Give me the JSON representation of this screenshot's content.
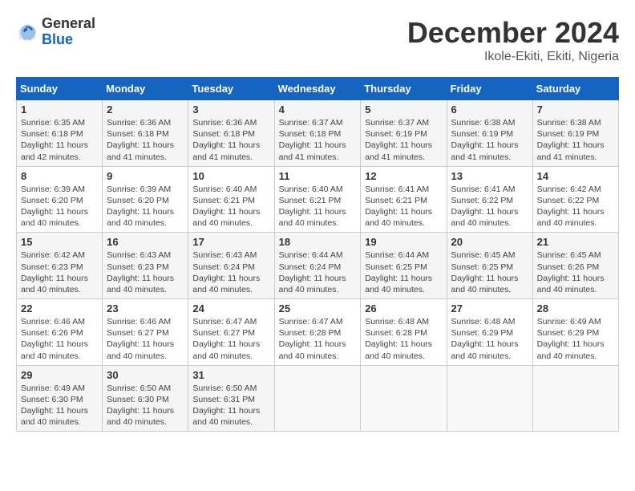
{
  "header": {
    "logo_general": "General",
    "logo_blue": "Blue",
    "month_title": "December 2024",
    "location": "Ikole-Ekiti, Ekiti, Nigeria"
  },
  "days_of_week": [
    "Sunday",
    "Monday",
    "Tuesday",
    "Wednesday",
    "Thursday",
    "Friday",
    "Saturday"
  ],
  "weeks": [
    [
      {
        "day": "1",
        "sunrise": "6:35 AM",
        "sunset": "6:18 PM",
        "daylight": "11 hours and 42 minutes."
      },
      {
        "day": "2",
        "sunrise": "6:36 AM",
        "sunset": "6:18 PM",
        "daylight": "11 hours and 41 minutes."
      },
      {
        "day": "3",
        "sunrise": "6:36 AM",
        "sunset": "6:18 PM",
        "daylight": "11 hours and 41 minutes."
      },
      {
        "day": "4",
        "sunrise": "6:37 AM",
        "sunset": "6:18 PM",
        "daylight": "11 hours and 41 minutes."
      },
      {
        "day": "5",
        "sunrise": "6:37 AM",
        "sunset": "6:19 PM",
        "daylight": "11 hours and 41 minutes."
      },
      {
        "day": "6",
        "sunrise": "6:38 AM",
        "sunset": "6:19 PM",
        "daylight": "11 hours and 41 minutes."
      },
      {
        "day": "7",
        "sunrise": "6:38 AM",
        "sunset": "6:19 PM",
        "daylight": "11 hours and 41 minutes."
      }
    ],
    [
      {
        "day": "8",
        "sunrise": "6:39 AM",
        "sunset": "6:20 PM",
        "daylight": "11 hours and 40 minutes."
      },
      {
        "day": "9",
        "sunrise": "6:39 AM",
        "sunset": "6:20 PM",
        "daylight": "11 hours and 40 minutes."
      },
      {
        "day": "10",
        "sunrise": "6:40 AM",
        "sunset": "6:21 PM",
        "daylight": "11 hours and 40 minutes."
      },
      {
        "day": "11",
        "sunrise": "6:40 AM",
        "sunset": "6:21 PM",
        "daylight": "11 hours and 40 minutes."
      },
      {
        "day": "12",
        "sunrise": "6:41 AM",
        "sunset": "6:21 PM",
        "daylight": "11 hours and 40 minutes."
      },
      {
        "day": "13",
        "sunrise": "6:41 AM",
        "sunset": "6:22 PM",
        "daylight": "11 hours and 40 minutes."
      },
      {
        "day": "14",
        "sunrise": "6:42 AM",
        "sunset": "6:22 PM",
        "daylight": "11 hours and 40 minutes."
      }
    ],
    [
      {
        "day": "15",
        "sunrise": "6:42 AM",
        "sunset": "6:23 PM",
        "daylight": "11 hours and 40 minutes."
      },
      {
        "day": "16",
        "sunrise": "6:43 AM",
        "sunset": "6:23 PM",
        "daylight": "11 hours and 40 minutes."
      },
      {
        "day": "17",
        "sunrise": "6:43 AM",
        "sunset": "6:24 PM",
        "daylight": "11 hours and 40 minutes."
      },
      {
        "day": "18",
        "sunrise": "6:44 AM",
        "sunset": "6:24 PM",
        "daylight": "11 hours and 40 minutes."
      },
      {
        "day": "19",
        "sunrise": "6:44 AM",
        "sunset": "6:25 PM",
        "daylight": "11 hours and 40 minutes."
      },
      {
        "day": "20",
        "sunrise": "6:45 AM",
        "sunset": "6:25 PM",
        "daylight": "11 hours and 40 minutes."
      },
      {
        "day": "21",
        "sunrise": "6:45 AM",
        "sunset": "6:26 PM",
        "daylight": "11 hours and 40 minutes."
      }
    ],
    [
      {
        "day": "22",
        "sunrise": "6:46 AM",
        "sunset": "6:26 PM",
        "daylight": "11 hours and 40 minutes."
      },
      {
        "day": "23",
        "sunrise": "6:46 AM",
        "sunset": "6:27 PM",
        "daylight": "11 hours and 40 minutes."
      },
      {
        "day": "24",
        "sunrise": "6:47 AM",
        "sunset": "6:27 PM",
        "daylight": "11 hours and 40 minutes."
      },
      {
        "day": "25",
        "sunrise": "6:47 AM",
        "sunset": "6:28 PM",
        "daylight": "11 hours and 40 minutes."
      },
      {
        "day": "26",
        "sunrise": "6:48 AM",
        "sunset": "6:28 PM",
        "daylight": "11 hours and 40 minutes."
      },
      {
        "day": "27",
        "sunrise": "6:48 AM",
        "sunset": "6:29 PM",
        "daylight": "11 hours and 40 minutes."
      },
      {
        "day": "28",
        "sunrise": "6:49 AM",
        "sunset": "6:29 PM",
        "daylight": "11 hours and 40 minutes."
      }
    ],
    [
      {
        "day": "29",
        "sunrise": "6:49 AM",
        "sunset": "6:30 PM",
        "daylight": "11 hours and 40 minutes."
      },
      {
        "day": "30",
        "sunrise": "6:50 AM",
        "sunset": "6:30 PM",
        "daylight": "11 hours and 40 minutes."
      },
      {
        "day": "31",
        "sunrise": "6:50 AM",
        "sunset": "6:31 PM",
        "daylight": "11 hours and 40 minutes."
      },
      null,
      null,
      null,
      null
    ]
  ]
}
